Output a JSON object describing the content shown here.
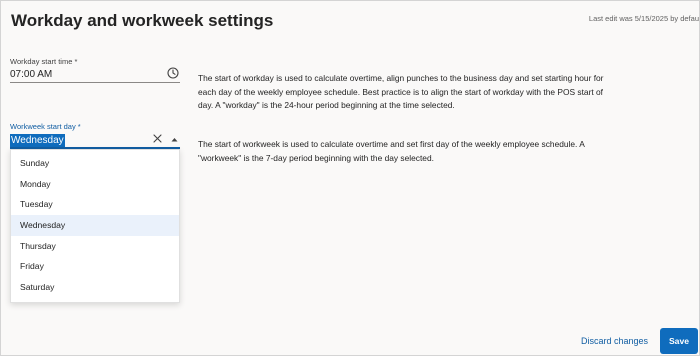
{
  "header": {
    "title": "Workday and workweek settings",
    "last_edit": "Last edit was 5/15/2025 by defau"
  },
  "workday": {
    "label": "Workday start time *",
    "value": "07:00 AM",
    "description": "The start of workday is used to calculate overtime, align punches to the business day and set starting hour for each day of the weekly employee schedule. Best practice is to align the start of workday with the POS start of day. A \"workday\" is the 24-hour period beginning at the time selected."
  },
  "workweek": {
    "label": "Workweek start day *",
    "value": "Wednesday",
    "description": "The start of workweek is used to calculate overtime and set first day of the weekly employee schedule. A \"workweek\" is the 7-day period beginning with the day selected.",
    "options": [
      "Sunday",
      "Monday",
      "Tuesday",
      "Wednesday",
      "Thursday",
      "Friday",
      "Saturday"
    ]
  },
  "footer": {
    "discard_label": "Discard changes",
    "save_label": "Save"
  },
  "colors": {
    "accent": "#0f6cbd",
    "link": "#115ea3",
    "selected_option_bg": "#eaf1fb"
  }
}
